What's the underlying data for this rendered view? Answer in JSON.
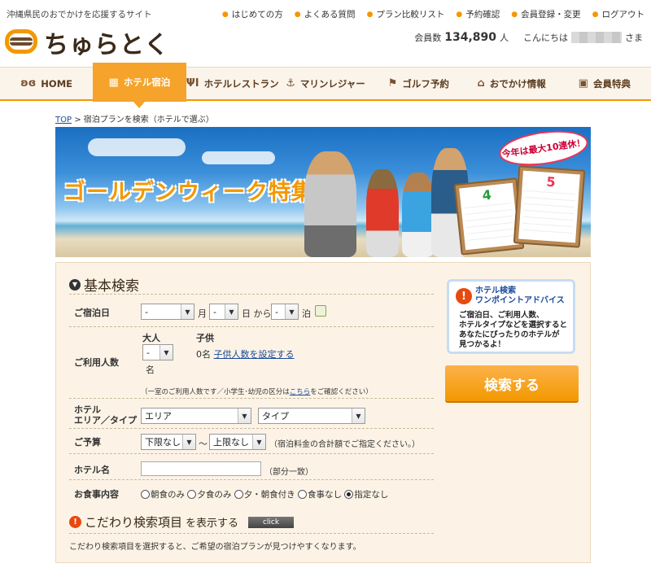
{
  "header": {
    "tagline": "沖縄県民のおでかけを応援するサイト",
    "top_links": [
      "はじめての方",
      "よくある質問",
      "プラン比較リスト",
      "予約確認",
      "会員登録・変更",
      "ログアウト"
    ],
    "logo_text": "ちゅらとく",
    "member_prefix": "会員数",
    "member_count": "134,890",
    "member_suffix": "人",
    "greeting": "こんにちは",
    "greeting_suffix": "さま"
  },
  "nav": [
    {
      "label": "HOME",
      "icon": "home-icon",
      "glyph": "ʚɞ"
    },
    {
      "label": "ホテル宿泊",
      "icon": "hotel-icon",
      "glyph": "▦"
    },
    {
      "label": "ホテルレストラン",
      "icon": "fork-knife-icon",
      "glyph": "ΨΙ"
    },
    {
      "label": "マリンレジャー",
      "icon": "anchor-icon",
      "glyph": "⚓"
    },
    {
      "label": "ゴルフ予約",
      "icon": "golf-flag-icon",
      "glyph": "⚑"
    },
    {
      "label": "おでかけ情報",
      "icon": "bag-icon",
      "glyph": "⌂"
    },
    {
      "label": "会員特典",
      "icon": "gift-icon",
      "glyph": "▣"
    }
  ],
  "breadcrumb": {
    "top": "TOP",
    "sep": " > ",
    "current": "宿泊プランを検索（ホテルで選ぶ）"
  },
  "banner": {
    "title": "ゴールデンウィーク特集",
    "badge": "今年は最大10連休！",
    "cal1_month": "4",
    "cal2_month": "5"
  },
  "search": {
    "title": "基本検索",
    "date_label": "ご宿泊日",
    "month_value": "-",
    "month_unit": "月",
    "day_value": "-",
    "day_unit": "日 から",
    "nights_value": "-",
    "nights_unit": "泊",
    "guests_label": "ご利用人数",
    "adult_header": "大人",
    "child_header": "子供",
    "adult_value": "-",
    "adult_unit": "名",
    "child_count": "0名",
    "child_link": "子供人数を設定する",
    "guests_note_pre": "（一室のご利用人数です／小学生･幼児の区分は",
    "guests_note_link": "こちら",
    "guests_note_post": "をご確認ください）",
    "area_label_1": "ホテル",
    "area_label_2": "エリア／タイプ",
    "area_value": "エリア",
    "type_value": "タイプ",
    "budget_label": "ご予算",
    "budget_min": "下限なし",
    "budget_tilde": "～",
    "budget_max": "上限なし",
    "budget_note": "（宿泊料金の合計額でご指定ください。）",
    "hotel_label": "ホテル名",
    "hotel_value": "",
    "hotel_note": "（部分一致）",
    "meal_label": "お食事内容",
    "meal_options": [
      "朝食のみ",
      "夕食のみ",
      "夕・朝食付き",
      "食事なし",
      "指定なし"
    ],
    "meal_selected": "指定なし",
    "advice_title_1": "ホテル検索",
    "advice_title_2": "ワンポイントアドバイス",
    "advice_body": [
      "ご宿泊日、ご利用人数、",
      "ホテルタイプなどを選択すると",
      "あなたにぴったりのホテルが",
      "見つかるよ！"
    ],
    "search_button": "検索する",
    "advanced_title_pre": "こだわり検索項目",
    "advanced_title_post": "を表示する",
    "advanced_click": "click",
    "advanced_note": "こだわり検索項目を選択すると、ご希望の宿泊プランが見つけやすくなります。"
  },
  "colors": {
    "accent": "#f39800",
    "link": "#1a4a9a",
    "panel_bg": "#fcf3e6"
  }
}
